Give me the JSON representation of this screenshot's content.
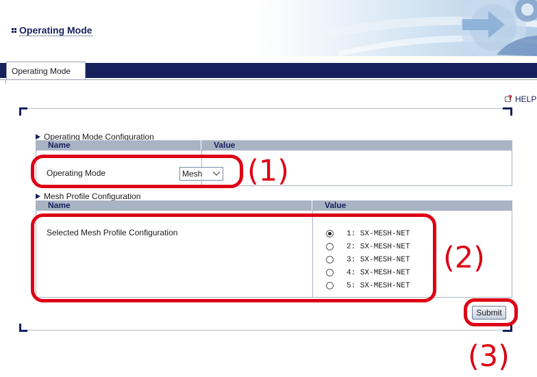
{
  "header": {
    "title": "Operating Mode"
  },
  "tabs": [
    {
      "label": "Operating Mode",
      "active": true
    }
  ],
  "help": {
    "label": "HELP",
    "icon": "help-book-icon"
  },
  "operating_mode_section": {
    "title": "Operating Mode Configuration",
    "columns": [
      "Name",
      "Value"
    ],
    "row": {
      "label": "Operating Mode",
      "selected_value": "Mesh"
    }
  },
  "mesh_profile_section": {
    "title": "Mesh Profile Configuration",
    "columns": [
      "Name",
      "Value"
    ],
    "row_label": "Selected Mesh Profile Configuration",
    "options": [
      {
        "label": "1: SX-MESH-NET",
        "checked": true
      },
      {
        "label": "2: SX-MESH-NET",
        "checked": false
      },
      {
        "label": "3: SX-MESH-NET",
        "checked": false
      },
      {
        "label": "4: SX-MESH-NET",
        "checked": false
      },
      {
        "label": "5: SX-MESH-NET",
        "checked": false
      }
    ]
  },
  "submit": {
    "label": "Submit"
  },
  "annotations": {
    "one": "(1)",
    "two": "(2)",
    "three": "(3)"
  },
  "colors": {
    "navy": "#16215c",
    "header_row": "#a8b3c4",
    "annotation_red": "#dd0015"
  }
}
